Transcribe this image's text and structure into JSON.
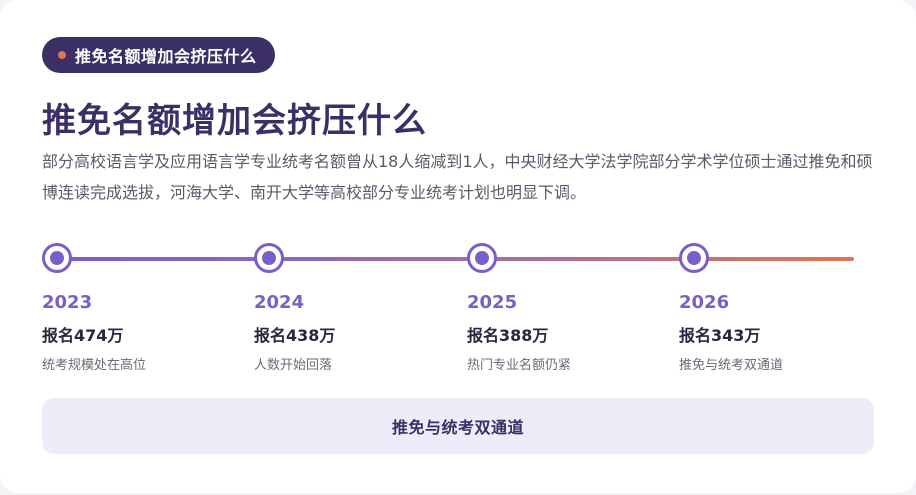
{
  "badge": {
    "label": "推免名额增加会挤压什么"
  },
  "title": "推免名额增加会挤压什么",
  "description": "部分高校语言学及应用语言学专业统考名额曾从18人缩减到1人，中央财经大学法学院部分学术学位硕士通过推免和硕博连读完成选拔，河海大学、南开大学等高校部分专业统考计划也明显下调。",
  "timeline": [
    {
      "year": "2023",
      "count": "报名474万",
      "note": "统考规模处在高位"
    },
    {
      "year": "2024",
      "count": "报名438万",
      "note": "人数开始回落"
    },
    {
      "year": "2025",
      "count": "报名388万",
      "note": "热门专业名额仍紧"
    },
    {
      "year": "2026",
      "count": "报名343万",
      "note": "推免与统考双通道"
    }
  ],
  "footer": {
    "label": "推免与统考双通道"
  },
  "colors": {
    "primary": "#3b2f66",
    "accent_purple": "#7a5fc7",
    "accent_orange": "#e17452",
    "footer_bg": "#efecf9"
  }
}
